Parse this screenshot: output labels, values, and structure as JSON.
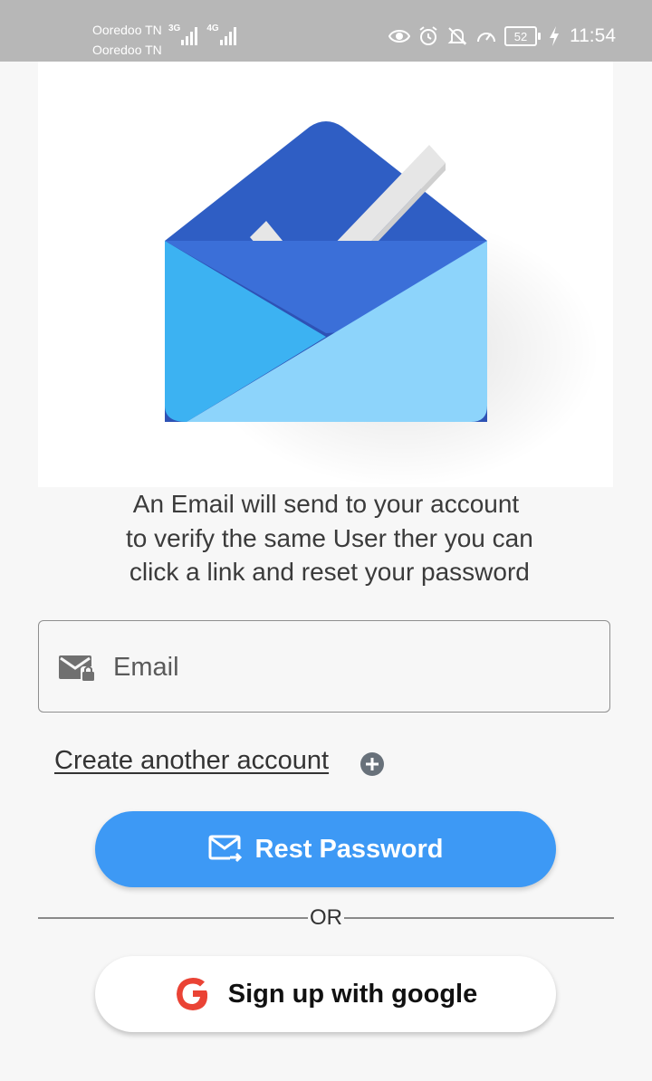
{
  "status_bar": {
    "carrier_1": "Ooredoo TN",
    "carrier_2": "Ooredoo TN",
    "network_1": "3G",
    "network_2": "4G",
    "battery_level": "52",
    "time": "11:54",
    "icons": [
      "eye-icon",
      "alarm-icon",
      "notifications-off-icon",
      "speedometer-icon",
      "battery-icon",
      "charging-icon"
    ]
  },
  "hero": {
    "image": "inbox-envelope-checkmark-logo"
  },
  "info": {
    "text": "An Email will send to your account\n to verify the same User ther you can\n click a link and reset your password"
  },
  "email_field": {
    "placeholder": "Email",
    "value": "",
    "icon": "mail-lock-icon"
  },
  "create_account": {
    "label": "Create another account",
    "icon": "add-circle-icon"
  },
  "reset_button": {
    "label": "Rest Password",
    "icon": "mail-send-icon",
    "color": "#3d99f5"
  },
  "divider": {
    "label": "OR"
  },
  "google_button": {
    "label": "Sign up with google",
    "icon": "google-g-icon",
    "icon_color": "#ea4335"
  }
}
